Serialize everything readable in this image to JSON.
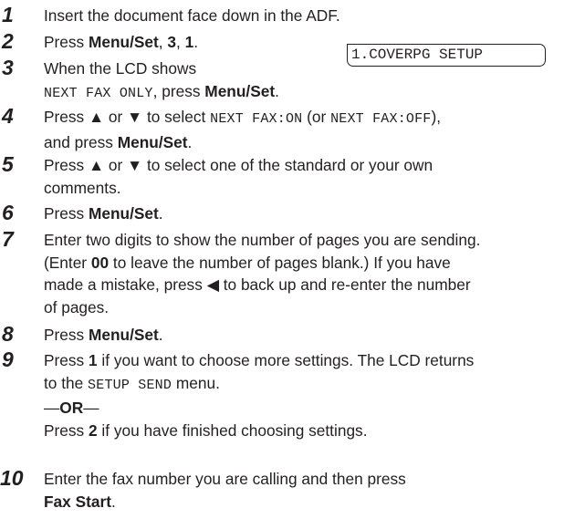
{
  "lcd": {
    "display": "1.COVERPG SETUP"
  },
  "steps": [
    {
      "num": "1",
      "parts": [
        [
          "t",
          "Insert the document face down in the ADF."
        ]
      ]
    },
    {
      "num": "2",
      "parts": [
        [
          "t",
          "Press "
        ],
        [
          "b",
          "Menu/Set"
        ],
        [
          "t",
          ", "
        ],
        [
          "b",
          "3"
        ],
        [
          "t",
          ", "
        ],
        [
          "b",
          "1"
        ],
        [
          "t",
          "."
        ]
      ]
    },
    {
      "num": "3",
      "lines": [
        [
          [
            "t",
            "When the LCD shows"
          ]
        ],
        [
          [
            "m",
            "NEXT FAX ONLY"
          ],
          [
            "t",
            ", press "
          ],
          [
            "b",
            "Menu/Set"
          ],
          [
            "t",
            "."
          ]
        ]
      ]
    },
    {
      "num": "4",
      "lines": [
        [
          [
            "t",
            "Press ▲ or ▼ to select "
          ],
          [
            "m",
            "NEXT FAX:ON"
          ],
          [
            "t",
            " (or "
          ],
          [
            "m",
            "NEXT FAX:OFF"
          ],
          [
            "t",
            ")"
          ],
          [
            "t",
            ","
          ]
        ],
        [
          [
            "t",
            "and press "
          ],
          [
            "b",
            "Menu/Set"
          ],
          [
            "t",
            "."
          ]
        ]
      ]
    },
    {
      "num": "5",
      "lines": [
        [
          [
            "t",
            "Press ▲ or ▼ to select one of the standard or your own"
          ]
        ],
        [
          [
            "t",
            "comments."
          ]
        ]
      ]
    },
    {
      "num": "6",
      "parts": [
        [
          "t",
          "Press "
        ],
        [
          "b",
          "Menu/Set"
        ],
        [
          "t",
          "."
        ]
      ]
    },
    {
      "num": "7",
      "lines": [
        [
          [
            "t",
            "Enter two digits to show the number of pages you are sending."
          ]
        ],
        [
          [
            "t",
            "(Enter "
          ],
          [
            "b",
            "00"
          ],
          [
            "t",
            " to leave the number of pages blank.) If you have"
          ]
        ],
        [
          [
            "t",
            "made a mistake, press ◀ to back up and re-enter the number"
          ]
        ],
        [
          [
            "t",
            "of pages."
          ]
        ]
      ]
    },
    {
      "num": "8",
      "parts": [
        [
          "t",
          "Press "
        ],
        [
          "b",
          "Menu/Set"
        ],
        [
          "t",
          "."
        ]
      ]
    },
    {
      "num": "9",
      "lines": [
        [
          [
            "t",
            "Press "
          ],
          [
            "b",
            "1"
          ],
          [
            "t",
            " if you want to choose more settings. The LCD returns"
          ]
        ],
        [
          [
            "t",
            "to the "
          ],
          [
            "m",
            "SETUP SEND"
          ],
          [
            "t",
            " menu."
          ]
        ],
        [
          [
            "t",
            "—"
          ],
          [
            "b",
            "OR"
          ],
          [
            "t",
            "—"
          ]
        ],
        [
          [
            "t",
            "Press "
          ],
          [
            "b",
            "2"
          ],
          [
            "t",
            " if you have finished choosing settings."
          ]
        ]
      ]
    },
    {
      "num": "10",
      "lines": [
        [
          [
            "t",
            "Enter the fax number you are calling and then press"
          ]
        ],
        [
          [
            "b",
            "Fax Start"
          ],
          [
            "t",
            "."
          ]
        ]
      ]
    }
  ]
}
